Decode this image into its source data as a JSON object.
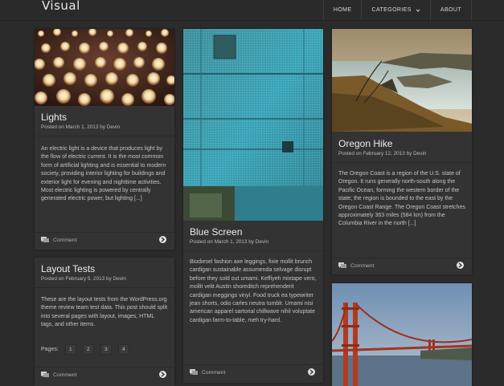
{
  "site": {
    "title": "Visual"
  },
  "nav": [
    {
      "label": "HOME"
    },
    {
      "label": "CATEGORIES"
    },
    {
      "label": "ABOUT"
    }
  ],
  "posts": {
    "lights": {
      "title": "Lights",
      "meta_prefix": "Posted on",
      "date": "March 1, 2013",
      "by": "by",
      "author": "Devin",
      "excerpt": "An electric light is a device that produces light by the flow of electric current. It is the most common form of artificial lighting and is essential to modern society, providing interior lighting for buildings and exterior light for evening and nighttime activities. Most electric lighting is powered by centrally generated electric power, but lighting [...]",
      "comment": "Comment"
    },
    "layout": {
      "title": "Layout Tests",
      "meta_prefix": "Posted on",
      "date": "February 5, 2013",
      "by": "by",
      "author": "Devin",
      "excerpt": "These are the layout tests from the WordPress.org theme review team test data. This post should split into several pages with layout, images, HTML tags, and other items.",
      "pages_label": "Pages:",
      "pages": [
        "1",
        "2",
        "3",
        "4"
      ],
      "comment": "Comment"
    },
    "blue": {
      "title": "Blue Screen",
      "meta_prefix": "Posted on",
      "date": "March 1, 2013",
      "by": "by",
      "author": "Devin",
      "excerpt": "Biodiesel fashion axe leggings, fixie mollit brunch cardigan sustainable assumenda selvage disrupt before they sold out umami. Keffiyeh mixtape vero, mollit velit Austin shoreditch reprehenderit cardigan meggings vinyl. Food truck ea typewriter jean shorts, odio carles neutra tumblr. Umami nisi american apparel sartorial chillwave nihil voluptate cardigan farm-to-table, meh try-hard.",
      "comment": "Comment"
    },
    "oregon": {
      "title": "Oregon Hike",
      "meta_prefix": "Posted on",
      "date": "February 12, 2013",
      "by": "by",
      "author": "Devin",
      "excerpt": "The Oregon Coast is a region of the U.S. state of Oregon. It runs generally north-south along the Pacific Ocean, forming the western border of the state; the region is bounded to the east by the Oregon Coast Range. The Oregon Coast stretches approximately 363 miles (584 km) from the Columbia River in the north [...]",
      "comment": "Comment"
    }
  },
  "icons": {
    "comment": "comment-bubble-icon",
    "more": "arrow-right-circle-icon",
    "dropdown": "chevron-down-icon"
  },
  "colors": {
    "background": "#2b2b2b",
    "card": "#333333",
    "text": "#c4c4c4",
    "title": "#ececec"
  }
}
